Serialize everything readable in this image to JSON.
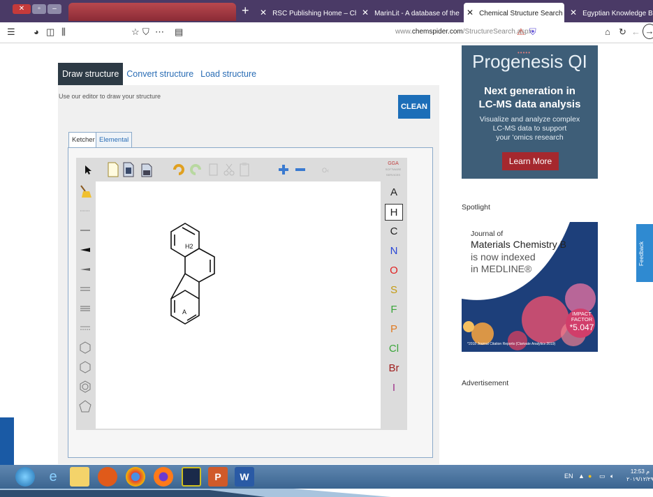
{
  "browser": {
    "tabs": [
      {
        "label": "RSC Publishing Home – Chem",
        "close": "✕"
      },
      {
        "label": "MarinLit - A database of the m",
        "close": "✕"
      },
      {
        "label": "Chemical Structure Search",
        "close": "✕"
      },
      {
        "label": "Egyptian Knowledge Bank",
        "close": "✕"
      }
    ],
    "new_tab": "+",
    "url_prefix": "www.",
    "url_host": "chemspider.com",
    "url_path": "/StructureSearch.aspx"
  },
  "page": {
    "tabs": [
      "Draw structure",
      "Convert structure",
      "Load structure"
    ],
    "subtitle": "Use our editor to draw your structure",
    "clean_label": "CLEAN",
    "editor_tabs": [
      "Ketcher",
      "Elemental"
    ],
    "logo_text": "GGA",
    "logo_sub": "SOFTWARE SERVICES",
    "atoms": [
      "A",
      "H",
      "C",
      "N",
      "O",
      "S",
      "F",
      "P",
      "Cl",
      "Br",
      "I"
    ],
    "atom_colors": {
      "A": "#222222",
      "H": "#222222",
      "C": "#222222",
      "N": "#2a47d6",
      "O": "#e02020",
      "S": "#c49a10",
      "F": "#3aa53a",
      "P": "#e07a22",
      "Cl": "#3aa53a",
      "Br": "#a02020",
      "I": "#a0308a"
    },
    "molecule_labels": {
      "h2": "H2",
      "a": "A"
    }
  },
  "ad": {
    "brand": "Progenesis QI",
    "headline_1": "Next generation in",
    "headline_2": "LC-MS data analysis",
    "body_1": "Visualize and analyze complex",
    "body_2": "LC-MS data to support",
    "body_3": "your 'omics research",
    "button": "Learn More"
  },
  "sidebar": {
    "spotlight": "Spotlight",
    "journal_1": "Journal of",
    "journal_2": "Materials Chemistry B",
    "journal_3": "is now indexed",
    "journal_4": "in MEDLINE®",
    "impact_label_1": "IMPACT",
    "impact_label_2": "FACTOR",
    "impact_value": "*5.047",
    "credit": "*2018 Journal Citation Reports (Clarivate Analytics 2019)",
    "advertisement": "Advertisement",
    "feedback": "Feedback"
  },
  "taskbar": {
    "lang": "EN",
    "time": "12:53 م",
    "date": "٢٠١٩/١٢/٢٩"
  }
}
